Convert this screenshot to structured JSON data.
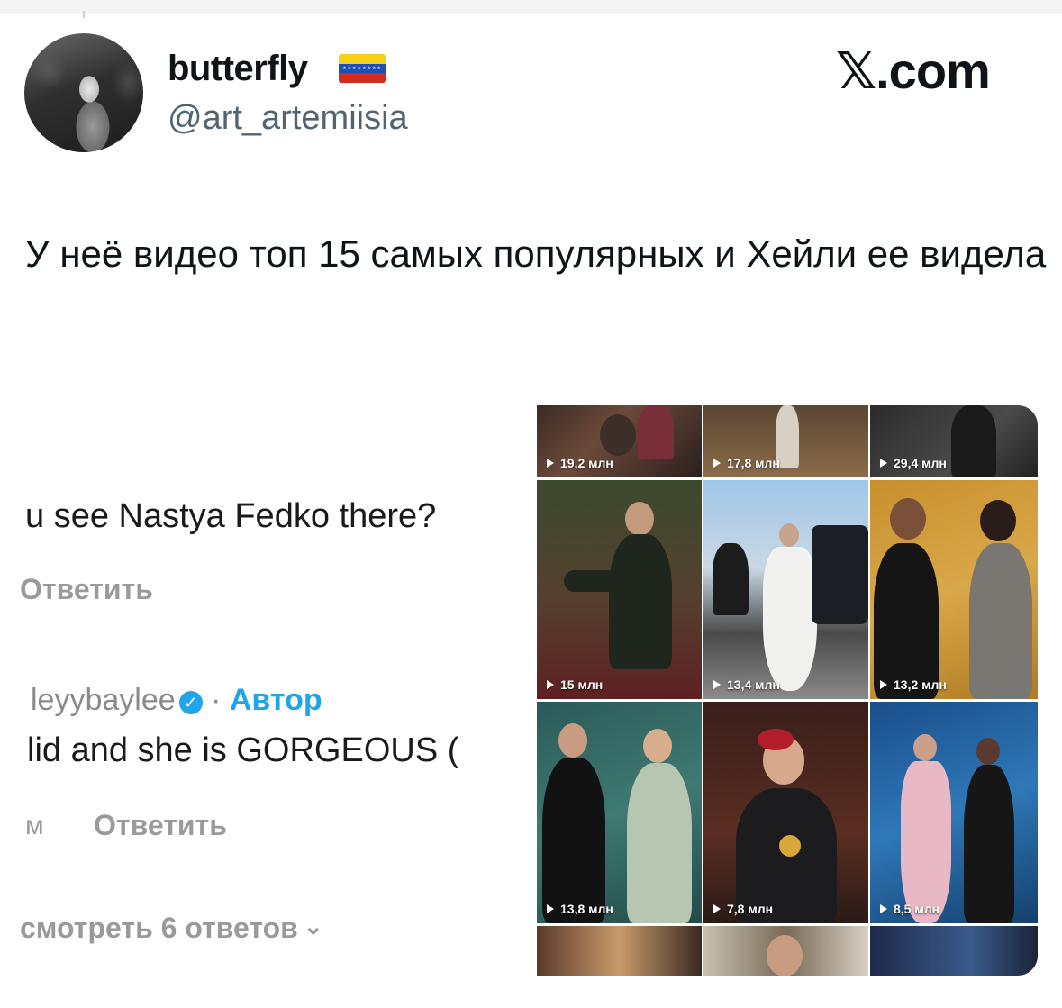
{
  "tweet": {
    "display_name": "butterfly",
    "flag": "Venezuela flag",
    "handle": "@art_artemiisia",
    "brand": "𝕏.com",
    "text": "У неё видео топ 15 самых популярных и Хейли ее видела"
  },
  "screenshot": {
    "comment_line": "u see Nastya Fedko there?",
    "reply_1": "Ответить",
    "author_name": "leyybaylee",
    "author_sep": " · ",
    "author_label": "Автор",
    "author_comment": "lid and she is GORGEOUS (",
    "time_fragment": "м",
    "reply_2": "Ответить",
    "view_replies": "смотреть 6 ответов",
    "video_views": [
      "19,2 млн",
      "17,8 млн",
      "29,4 млн",
      "15 млн",
      "13,4 млн",
      "13,2 млн",
      "13,8 млн",
      "7,8 млн",
      "8,5 млн"
    ]
  },
  "colors": {
    "link_blue": "#20a6e8",
    "text": "#0f1419",
    "secondary": "#536471"
  },
  "icons": [
    "play-icon",
    "verified-icon",
    "chevron-down-icon"
  ]
}
